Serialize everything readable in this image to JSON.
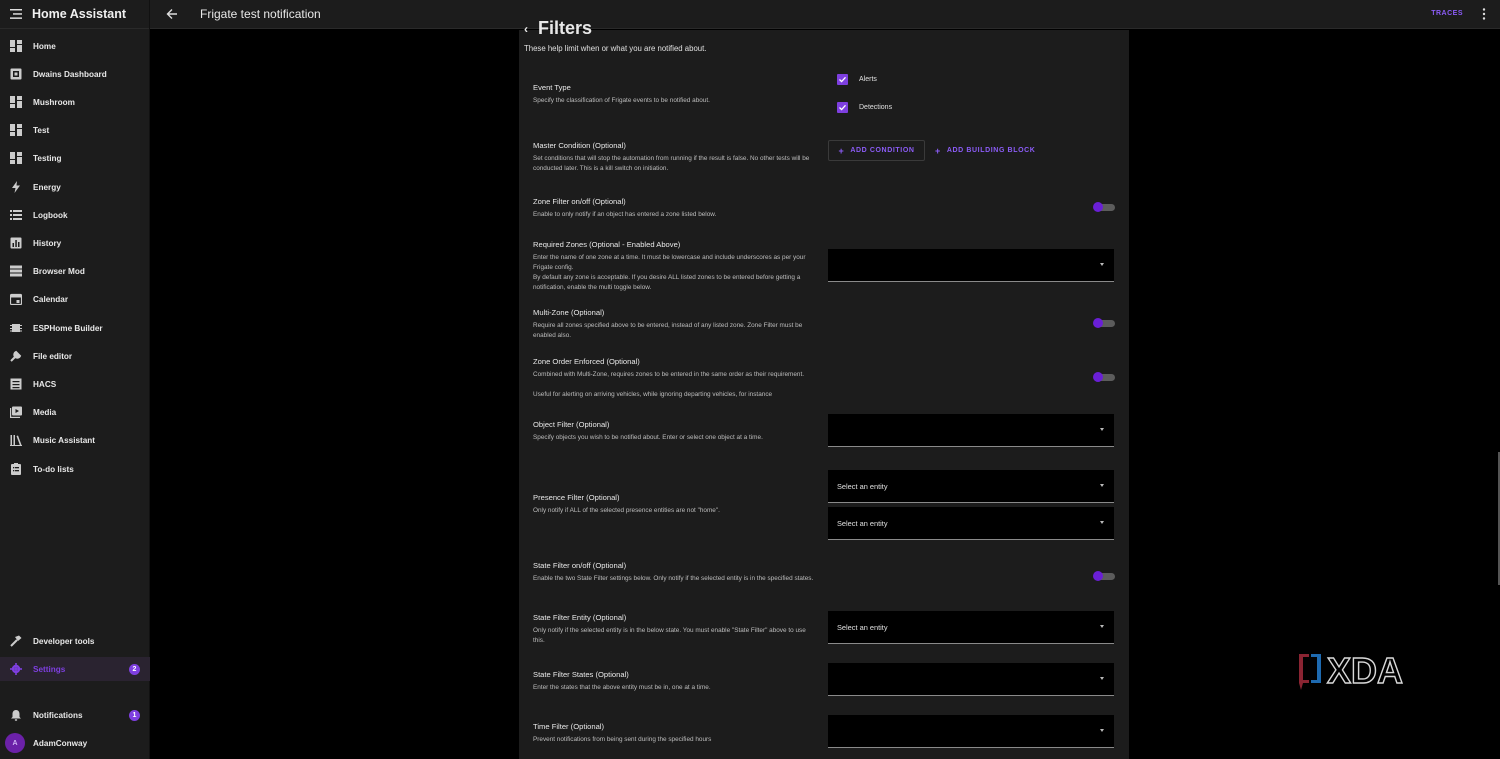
{
  "app": {
    "title": "Home Assistant"
  },
  "sidebar": {
    "items": [
      {
        "label": "Home",
        "icon": "dashboard-icon"
      },
      {
        "label": "Dwains Dashboard",
        "icon": "dashboard-box-icon"
      },
      {
        "label": "Mushroom",
        "icon": "dashboard-icon"
      },
      {
        "label": "Test",
        "icon": "dashboard-icon"
      },
      {
        "label": "Testing",
        "icon": "dashboard-icon"
      },
      {
        "label": "Energy",
        "icon": "lightning-icon"
      },
      {
        "label": "Logbook",
        "icon": "list-icon"
      },
      {
        "label": "History",
        "icon": "chart-box-icon"
      },
      {
        "label": "Browser Mod",
        "icon": "server-icon"
      },
      {
        "label": "Calendar",
        "icon": "calendar-icon"
      },
      {
        "label": "ESPHome Builder",
        "icon": "chip-icon"
      },
      {
        "label": "File editor",
        "icon": "wrench-icon"
      },
      {
        "label": "HACS",
        "icon": "hacs-icon"
      },
      {
        "label": "Media",
        "icon": "play-box-icon"
      },
      {
        "label": "Music Assistant",
        "icon": "music-library-icon"
      },
      {
        "label": "To-do lists",
        "icon": "clipboard-list-icon"
      }
    ],
    "developer_tools": "Developer tools",
    "settings": {
      "label": "Settings",
      "badge": "2"
    },
    "notifications": {
      "label": "Notifications",
      "badge": "1"
    },
    "user": {
      "name": "AdamConway",
      "initial": "A"
    }
  },
  "topbar": {
    "title": "Frigate test notification",
    "traces": "TRACES"
  },
  "card": {
    "title": "Filters",
    "subtitle": "These help limit when or what you are notified about.",
    "event_type": {
      "title": "Event Type",
      "desc": "Specify the classification of Frigate events to be notified about.",
      "options": [
        "Alerts",
        "Detections"
      ]
    },
    "master_condition": {
      "title": "Master Condition (Optional)",
      "desc": "Set conditions that will stop the automation from running if the result is false. No other tests will be conducted later. This is a kill switch on initiation.",
      "add_condition": "ADD CONDITION",
      "add_block": "ADD BUILDING BLOCK"
    },
    "zone_filter": {
      "title": "Zone Filter on/off (Optional)",
      "desc": "Enable to only notify if an object has entered a zone listed below."
    },
    "required_zones": {
      "title": "Required Zones (Optional - Enabled Above)",
      "desc1": "Enter the name of one zone at a time. It must be lowercase and include underscores as per your Frigate config.",
      "desc2": "By default any zone is acceptable. If you desire ALL listed zones to be entered before getting a notification, enable the multi toggle below."
    },
    "multi_zone": {
      "title": "Multi-Zone (Optional)",
      "desc": "Require all zones specified above to be entered, instead of any listed zone. Zone Filter must be enabled also."
    },
    "zone_order": {
      "title": "Zone Order Enforced (Optional)",
      "desc1": "Combined with Multi-Zone, requires zones to be entered in the same order as their requirement.",
      "desc2": "Useful for alerting on arriving vehicles, while ignoring departing vehicles, for instance"
    },
    "object_filter": {
      "title": "Object Filter (Optional)",
      "desc": "Specify objects you wish to be notified about. Enter or select one object at a time."
    },
    "presence_filter": {
      "title": "Presence Filter (Optional)",
      "desc": "Only notify if ALL of the selected presence entities are not \"home\".",
      "select1": "Select an entity",
      "select2": "Select an entity"
    },
    "state_filter": {
      "title": "State Filter on/off (Optional)",
      "desc": "Enable the two State Filter settings below. Only notify if the selected entity is in the specified states."
    },
    "state_entity": {
      "title": "State Filter Entity (Optional)",
      "desc": "Only notify if the selected entity is in the below state. You must enable \"State Filter\" above to use this.",
      "select": "Select an entity"
    },
    "state_states": {
      "title": "State Filter States (Optional)",
      "desc": "Enter the states that the above entity must be in, one at a time."
    },
    "time_filter": {
      "title": "Time Filter (Optional)",
      "desc": "Prevent notifications from being sent during the specified hours"
    }
  },
  "watermark": "XDA",
  "colors": {
    "accent": "#7e3fe0",
    "sidebar_bg": "#1c1c1c",
    "card_bg": "#1c1c1c",
    "page_bg": "#000000"
  }
}
